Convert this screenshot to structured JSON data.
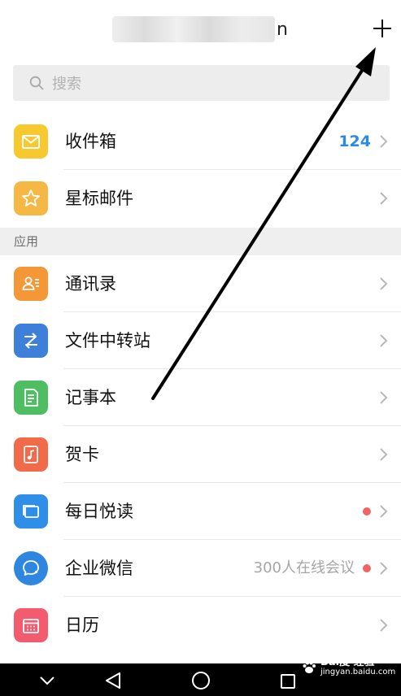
{
  "header": {
    "account_suffix": "n",
    "icons": {
      "add": "plus-icon"
    }
  },
  "search": {
    "placeholder": "搜索",
    "icon": "search-icon"
  },
  "mail": [
    {
      "label": "收件箱",
      "count": "124",
      "icon": "envelope-icon",
      "color": "#f7c92e"
    },
    {
      "label": "星标邮件",
      "icon": "star-icon",
      "color": "#f5b845"
    }
  ],
  "section_title": "应用",
  "apps": [
    {
      "label": "通讯录",
      "icon": "contacts-icon",
      "color": "#f49736"
    },
    {
      "label": "文件中转站",
      "icon": "transfer-icon",
      "color": "#3d7fd9"
    },
    {
      "label": "记事本",
      "icon": "notepad-icon",
      "color": "#4fbe62"
    },
    {
      "label": "贺卡",
      "icon": "greeting-card-icon",
      "color": "#f16a4a"
    },
    {
      "label": "每日悦读",
      "icon": "reading-icon",
      "color": "#2f8ee8",
      "badge_dot": true
    },
    {
      "label": "企业微信",
      "icon": "wework-icon",
      "color": "#2f86e0",
      "note": "300人在线会议",
      "badge_dot": true
    },
    {
      "label": "日历",
      "icon": "calendar-icon",
      "color": "#f35b6f"
    }
  ],
  "colors": {
    "accent_blue": "#2a8ae8",
    "dot_red": "#f06464",
    "section_bg": "#efefef"
  },
  "watermark": {
    "brand": "Bai度 经验",
    "url": "jingyan.baidu.com"
  },
  "navbar": {
    "icons": [
      "chevron-down-icon",
      "back-icon",
      "home-icon",
      "recents-icon"
    ]
  }
}
